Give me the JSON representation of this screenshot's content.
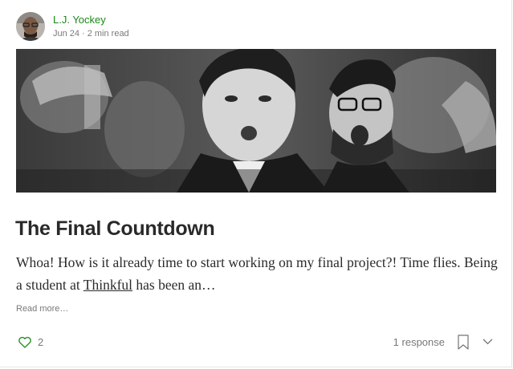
{
  "author": {
    "name": "L.J. Yockey",
    "date": "Jun 24",
    "separator": "·",
    "read_time": "2 min read"
  },
  "post": {
    "title": "The Final Countdown",
    "snippet_before": "Whoa! How is it already time to start working on my final project?! Time flies. Being a student at ",
    "snippet_link": "Thinkful",
    "snippet_after": " has been an…",
    "read_more": "Read more…",
    "hero_image": "grayscale-photo-two-men-shouting"
  },
  "footer": {
    "claps": "2",
    "responses": "1 response",
    "icons": {
      "clap": "heart-icon",
      "bookmark": "bookmark-icon",
      "more": "chevron-down-icon"
    }
  },
  "colors": {
    "author_link": "#1a8917",
    "clap_icon": "#1a8917",
    "muted_text": "rgba(0,0,0,0.54)"
  }
}
